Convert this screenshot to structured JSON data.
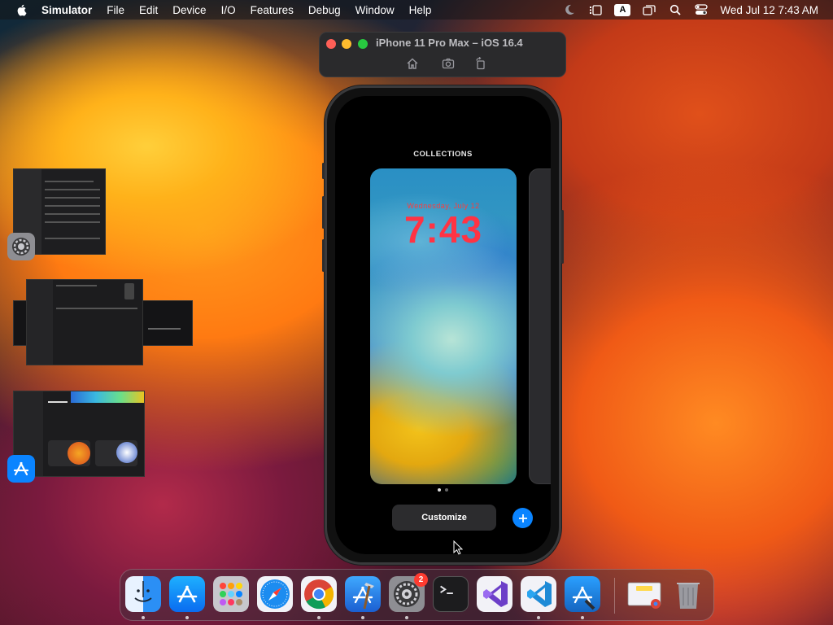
{
  "menubar": {
    "app_name": "Simulator",
    "items": [
      "File",
      "Edit",
      "Device",
      "I/O",
      "Features",
      "Debug",
      "Window",
      "Help"
    ],
    "input_source": "A",
    "clock": "Wed Jul 12  7:43 AM"
  },
  "simulator": {
    "title": "iPhone 11 Pro Max – iOS 16.4"
  },
  "lockscreen": {
    "heading": "COLLECTIONS",
    "date_label": "Wednesday, July 12",
    "time": "7:43",
    "customize_label": "Customize",
    "page_count": 2,
    "current_page": 1
  },
  "dock": {
    "apps": [
      "finder",
      "app-store",
      "launchpad",
      "safari",
      "chrome",
      "xcode",
      "system-settings",
      "terminal",
      "visual-studio",
      "vscode",
      "instruments"
    ],
    "settings_badge": "2"
  },
  "colors": {
    "accent": "#0a84ff",
    "lock_time": "#ff3344"
  }
}
